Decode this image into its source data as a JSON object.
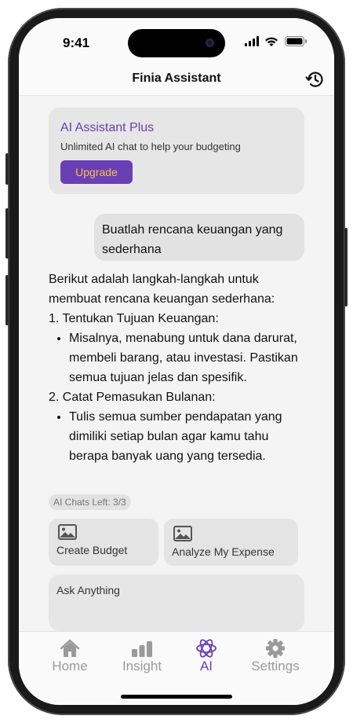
{
  "status_bar": {
    "time": "9:41"
  },
  "header": {
    "title": "Finia Assistant",
    "history_icon": "history-icon"
  },
  "promo": {
    "title": "AI Assistant Plus",
    "subtitle": "Unlimited AI chat to help your budgeting",
    "button_label": "Upgrade"
  },
  "chat": {
    "user_message": "Buatlah rencana keuangan yang sederhana",
    "ai_intro": "Berikut adalah langkah-langkah untuk membuat rencana keuangan sederhana:",
    "steps": [
      {
        "heading": "1. Tentukan Tujuan Keuangan:",
        "detail": "Misalnya, menabung untuk dana darurat, membeli barang, atau investasi. Pastikan semua tujuan jelas dan spesifik."
      },
      {
        "heading": "2. Catat Pemasukan Bulanan:",
        "detail": "Tulis semua sumber pendapatan yang dimiliki setiap bulan agar kamu tahu berapa banyak uang yang tersedia."
      }
    ],
    "chats_left": "AI Chats Left: 3/3"
  },
  "suggestions": [
    {
      "label": "Create Budget",
      "icon": "image-icon"
    },
    {
      "label": "Analyze My Expense",
      "icon": "image-icon"
    }
  ],
  "input": {
    "placeholder": "Ask Anything"
  },
  "tabs": [
    {
      "label": "Home",
      "icon": "home-icon",
      "active": false
    },
    {
      "label": "Insight",
      "icon": "bar-chart-icon",
      "active": false
    },
    {
      "label": "AI",
      "icon": "ai-atom-icon",
      "active": true
    },
    {
      "label": "Settings",
      "icon": "gear-icon",
      "active": false
    }
  ],
  "colors": {
    "accent": "#6a3fb5",
    "upgrade_text": "#f5c24a",
    "inactive_tab": "#9a9a9a"
  }
}
